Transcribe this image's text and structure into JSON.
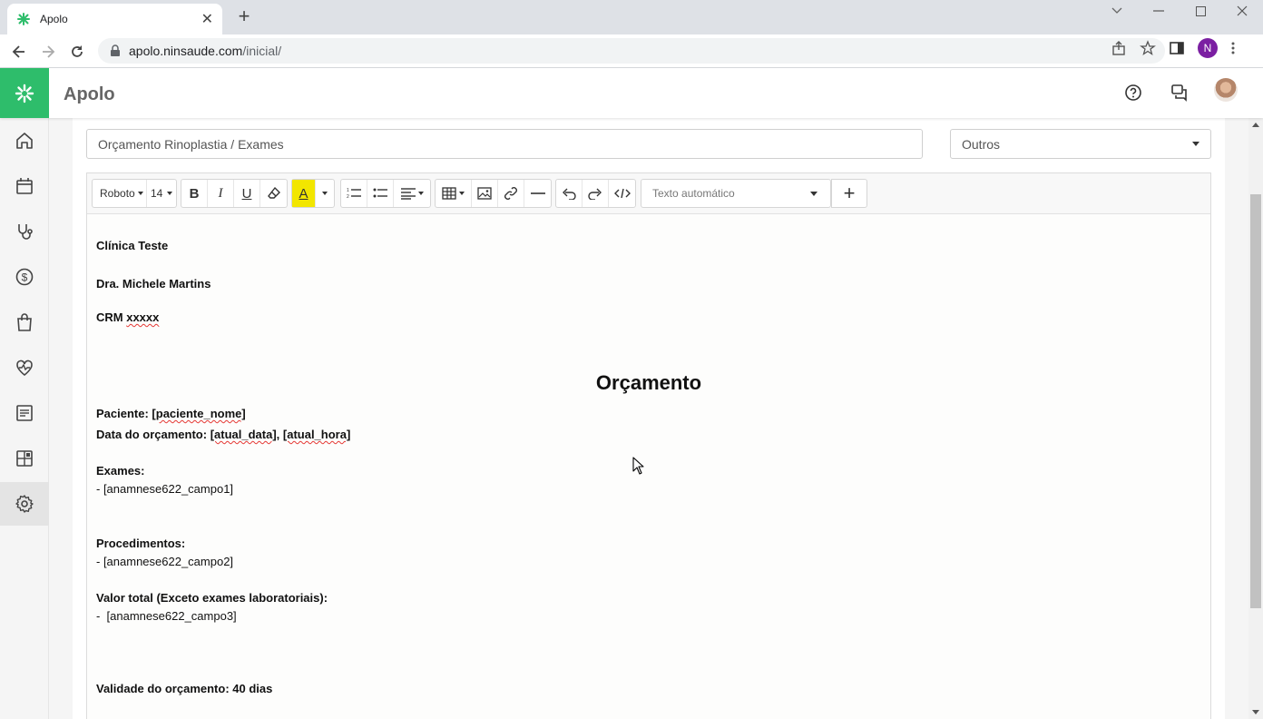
{
  "browser": {
    "tab_title": "Apolo",
    "url_host": "apolo.ninsaude.com",
    "url_path": "/inicial/",
    "profile_initial": "N"
  },
  "app": {
    "title": "Apolo",
    "brand_color": "#2ebd6b"
  },
  "sidebar": {
    "items": [
      {
        "icon": "home-icon"
      },
      {
        "icon": "calendar-icon"
      },
      {
        "icon": "stethoscope-icon"
      },
      {
        "icon": "dollar-icon"
      },
      {
        "icon": "shopping-bag-icon"
      },
      {
        "icon": "heart-pulse-icon"
      },
      {
        "icon": "document-list-icon"
      },
      {
        "icon": "dashboard-icon"
      },
      {
        "icon": "settings-icon",
        "active": true
      }
    ]
  },
  "form": {
    "name_value": "Orçamento Rinoplastia / Exames",
    "type_value": "Outros"
  },
  "toolbar": {
    "font_family": "Roboto",
    "font_size": "14",
    "auto_text_placeholder": "Texto automático",
    "plus_label": "+"
  },
  "document": {
    "clinic": "Clínica Teste",
    "doctor": "Dra. Michele Martins",
    "crm_label": "CRM ",
    "crm_value": "xxxxx",
    "heading": "Orçamento",
    "patient_label": "Paciente: ",
    "patient_var": "[paciente_nome]",
    "date_label": "Data do orçamento: ",
    "date_var": "[atual_data]",
    "date_sep": ", ",
    "time_var": "[atual_hora]",
    "exams_label": "Exames:",
    "exams_value": "- [anamnese622_campo1]",
    "procedures_label": "Procedimentos:",
    "procedures_value": "- [anamnese622_campo2]",
    "total_label": "Valor total (Exceto exames laboratoriais):",
    "total_value": "-  [anamnese622_campo3]",
    "validity": "Validade do orçamento: 40 dias"
  }
}
